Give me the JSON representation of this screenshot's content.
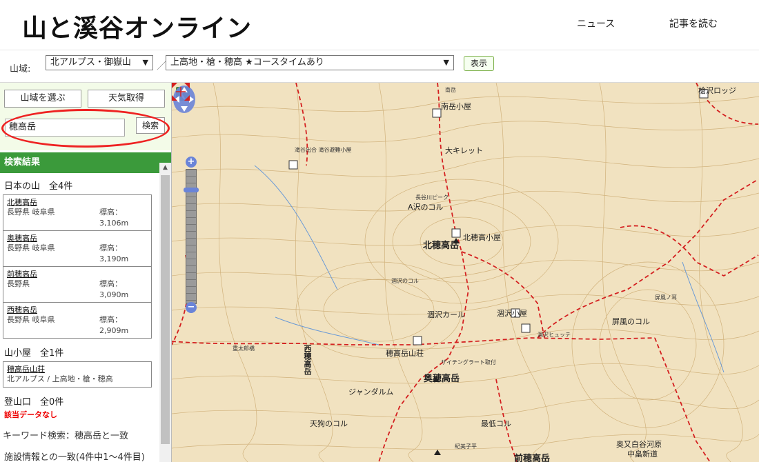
{
  "header": {
    "logo": "山と溪谷オンライン",
    "nav": [
      {
        "label": "ニュース"
      },
      {
        "label": "記事を読む"
      }
    ]
  },
  "region_bar": {
    "label": "山域:",
    "region_select": "北アルプス・御嶽山",
    "area_select": "上高地・槍・穂高 ★コースタイムあり",
    "show_button": "表示"
  },
  "sidebar": {
    "choose_region_button": "山域を選ぶ",
    "weather_button": "天気取得",
    "search_value": "穂高岳",
    "search_button": "検索",
    "results_header": "検索結果",
    "mountains": {
      "title": "日本の山　全4件",
      "elev_label": "標高：",
      "items": [
        {
          "name": "北穂高岳",
          "pref": "長野県 岐阜県",
          "elev": "3,106m"
        },
        {
          "name": "奥穂高岳",
          "pref": "長野県 岐阜県",
          "elev": "3,190m"
        },
        {
          "name": "前穂高岳",
          "pref": "長野県",
          "elev": "3,090m"
        },
        {
          "name": "西穂高岳",
          "pref": "長野県 岐阜県",
          "elev": "2,909m"
        }
      ]
    },
    "huts": {
      "title": "山小屋　全1件",
      "items": [
        {
          "name": "穂高岳山荘",
          "area": "北アルプス / 上高地・槍・穂高"
        }
      ]
    },
    "trailheads": {
      "title": "登山口　全0件",
      "empty": "該当データなし"
    },
    "keyword_line": "キーワード検索：穂高岳と一致",
    "facility_line": "施設情報との一致(4件中1～4件目)"
  },
  "map": {
    "collapse_icon": "chevron-left-icon",
    "labels": {
      "kitahotaka": "北穂高岳",
      "okuhotaka": "奥穂高岳",
      "maehotaka": "前穂高岳",
      "nishihotaka": "西穂高岳",
      "hotaka_sanso": "穂高岳山荘",
      "karasawa_hut": "涸沢小屋",
      "karasawa_hutte": "涸沢ヒュッテ",
      "kitahotaka_hut": "北穂高小屋",
      "minamidake_hut": "南岳小屋",
      "takidani_hut": "滝谷出合 滝谷避難小屋",
      "daikiretto": "大キレット",
      "jandarumu": "ジャンダルム",
      "tengu_col": "天狗のコル",
      "saitei_col": "最低コル",
      "byobu_col": "屏風のコル",
      "yokoo_lodge": "槍沢ロッジ",
      "minamidake": "南岳",
      "okumatashiro": "奥又白谷河原",
      "nakahata": "中畠新道",
      "kimitaira": "紀美子平",
      "byobunomimi": "屏風ノ耳",
      "saitei_route": "ザイテングラート取付",
      "karasawa_kaisho": "涸沢カール",
      "nagatani": "長谷川ピーク",
      "a_col": "A沢のコル",
      "shinhotaka_label": "涸沢のコル",
      "juutarou": "重太郎橋"
    }
  }
}
